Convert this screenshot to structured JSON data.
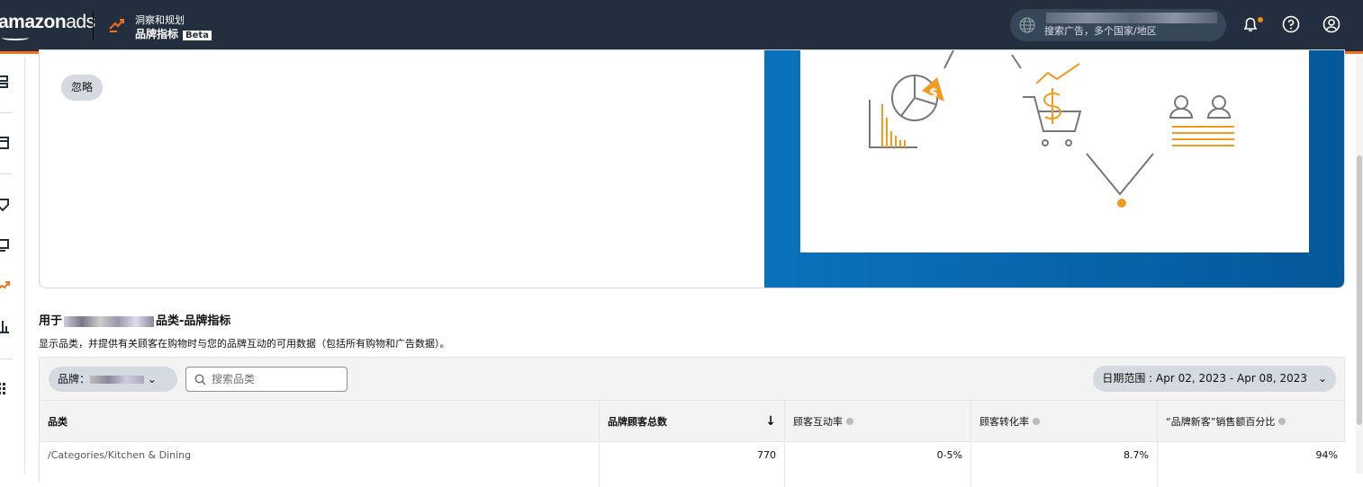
{
  "header": {
    "logo": "amazonads",
    "app_section": "洞察和规划",
    "app_name": "品牌指标",
    "beta": "Beta",
    "search_placeholder": "搜索广告，多个国家/地区",
    "accent": "#f2711c"
  },
  "promo": {
    "ignore_label": "忽略"
  },
  "section": {
    "title_prefix": "用于",
    "title_suffix": "品类-品牌指标",
    "description": "显示品类，并提供有关顾客在购物时与您的品牌互动的可用数据（包括所有购物和广告数据）。"
  },
  "toolbar": {
    "brand_label": "品牌：",
    "search_placeholder": "搜索品类",
    "date_range": "日期范围 : Apr 02, 2023 - Apr 08, 2023"
  },
  "table": {
    "headers": [
      "品类",
      "品牌顾客总数",
      "顾客互动率",
      "顾客转化率",
      "“品牌新客”销售额百分比"
    ],
    "rows": [
      {
        "category": "/Categories/Kitchen & Dining",
        "total": "770",
        "engagement": "0-5%",
        "conversion": "8.7%",
        "ntb": "94%"
      }
    ]
  }
}
